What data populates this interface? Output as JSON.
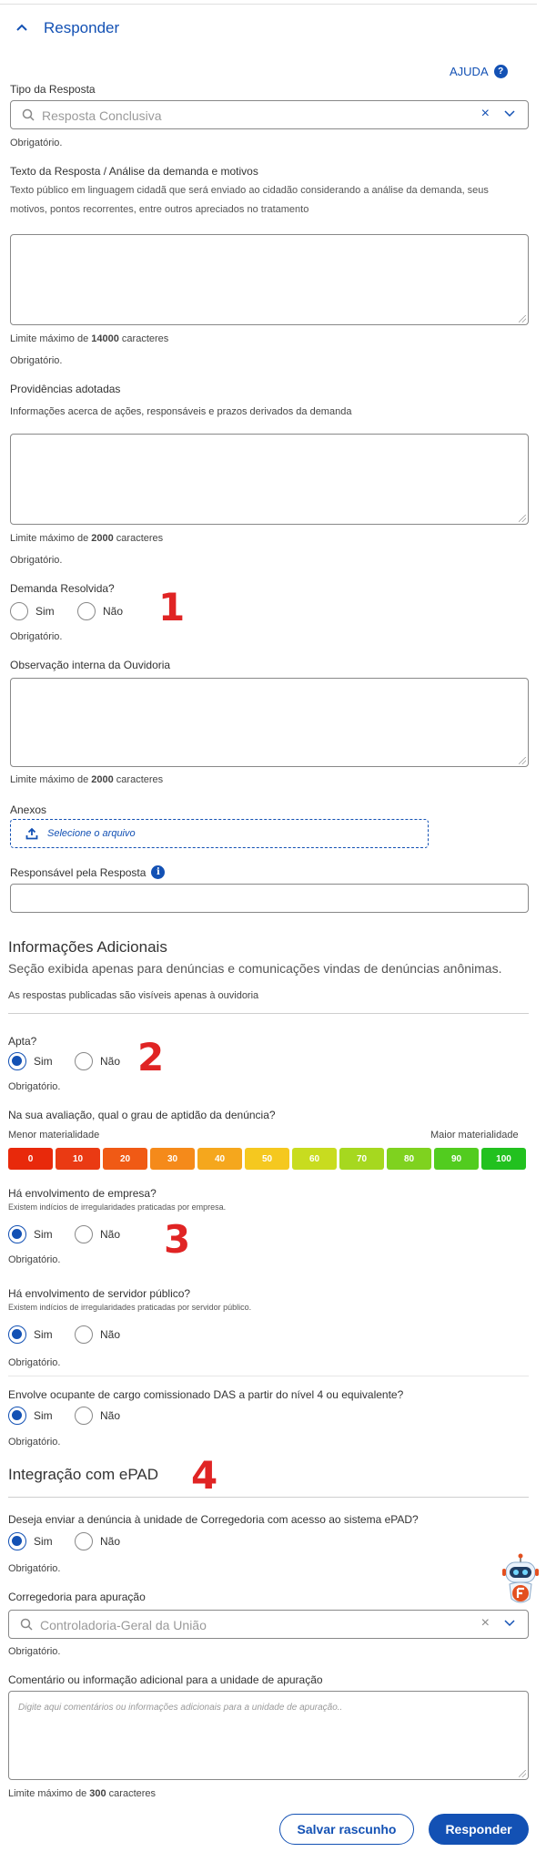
{
  "header": {
    "title": "Responder",
    "help": "AJUDA"
  },
  "tipo": {
    "label": "Tipo da Resposta",
    "placeholder": "Resposta Conclusiva",
    "required": "Obrigatório."
  },
  "texto": {
    "label": "Texto da Resposta / Análise da demanda e motivos",
    "hint": "Texto público em linguagem cidadã que será enviado ao cidadão considerando a análise da demanda, seus motivos, pontos recorrentes, entre outros apreciados no tratamento",
    "limit_prefix": "Limite máximo de ",
    "limit_value": "14000",
    "limit_suffix": " caracteres",
    "required": "Obrigatório."
  },
  "providencias": {
    "label": "Providências adotadas",
    "hint": "Informações acerca de ações, responsáveis e prazos derivados da demanda",
    "limit_prefix": "Limite máximo de ",
    "limit_value": "2000",
    "limit_suffix": " caracteres",
    "required": "Obrigatório."
  },
  "resolvida": {
    "label": "Demanda Resolvida?",
    "yes": "Sim",
    "no": "Não",
    "required": "Obrigatório.",
    "marker": "1"
  },
  "observacao": {
    "label": "Observação interna da Ouvidoria",
    "limit_prefix": "Limite máximo de ",
    "limit_value": "2000",
    "limit_suffix": " caracteres"
  },
  "anexos": {
    "label": "Anexos",
    "button": "Selecione o arquivo"
  },
  "responsavel": {
    "label": "Responsável pela Resposta"
  },
  "info": {
    "title": "Informações Adicionais",
    "subtitle": "Seção exibida apenas para denúncias e comunicações vindas de denúncias anônimas.",
    "note": "As respostas publicadas são visíveis apenas à ouvidoria"
  },
  "apta": {
    "label": "Apta?",
    "yes": "Sim",
    "no": "Não",
    "required": "Obrigatório.",
    "marker": "2",
    "selected": "Sim"
  },
  "grau": {
    "label": "Na sua avaliação, qual o grau de aptidão da denúncia?",
    "min": "Menor materialidade",
    "max": "Maior materialidade",
    "scale": [
      {
        "v": "0",
        "color": "#e8290b"
      },
      {
        "v": "10",
        "color": "#ea3a13"
      },
      {
        "v": "20",
        "color": "#f05a15"
      },
      {
        "v": "30",
        "color": "#f58a1a"
      },
      {
        "v": "40",
        "color": "#f5a71d"
      },
      {
        "v": "50",
        "color": "#f5c81f"
      },
      {
        "v": "60",
        "color": "#c8dc1f"
      },
      {
        "v": "70",
        "color": "#a6d81f"
      },
      {
        "v": "80",
        "color": "#7fd21f"
      },
      {
        "v": "90",
        "color": "#52cc1f"
      },
      {
        "v": "100",
        "color": "#22c11f"
      }
    ]
  },
  "empresa": {
    "label": "Há envolvimento de empresa?",
    "hint": "Existem indícios de irregularidades praticadas por empresa.",
    "yes": "Sim",
    "no": "Não",
    "required": "Obrigatório.",
    "marker": "3",
    "selected": "Sim"
  },
  "servidor": {
    "label": "Há envolvimento de servidor público?",
    "hint": "Existem indícios de irregularidades praticadas por servidor público.",
    "yes": "Sim",
    "no": "Não",
    "required": "Obrigatório.",
    "selected": "Sim"
  },
  "das": {
    "label": "Envolve ocupante de cargo comissionado DAS a partir do nível 4 ou equivalente?",
    "yes": "Sim",
    "no": "Não",
    "required": "Obrigatório.",
    "selected": "Sim"
  },
  "epad": {
    "title": "Integração com ePAD",
    "marker": "4",
    "question": "Deseja enviar a denúncia à unidade de Corregedoria com acesso ao sistema ePAD?",
    "yes": "Sim",
    "no": "Não",
    "required": "Obrigatório.",
    "selected": "Sim"
  },
  "corregedoria": {
    "label": "Corregedoria para apuração",
    "value": "Controladoria-Geral da União",
    "required": "Obrigatório."
  },
  "comentario": {
    "label": "Comentário ou informação adicional para a unidade de apuração",
    "placeholder": "Digite aqui comentários ou informações adicionais para a unidade de apuração..",
    "limit_prefix": "Limite máximo de ",
    "limit_value": "300",
    "limit_suffix": " caracteres"
  },
  "actions": {
    "draft": "Salvar rascunho",
    "submit": "Responder"
  },
  "colors": {
    "primary": "#1351b4",
    "marker": "#e02424"
  }
}
